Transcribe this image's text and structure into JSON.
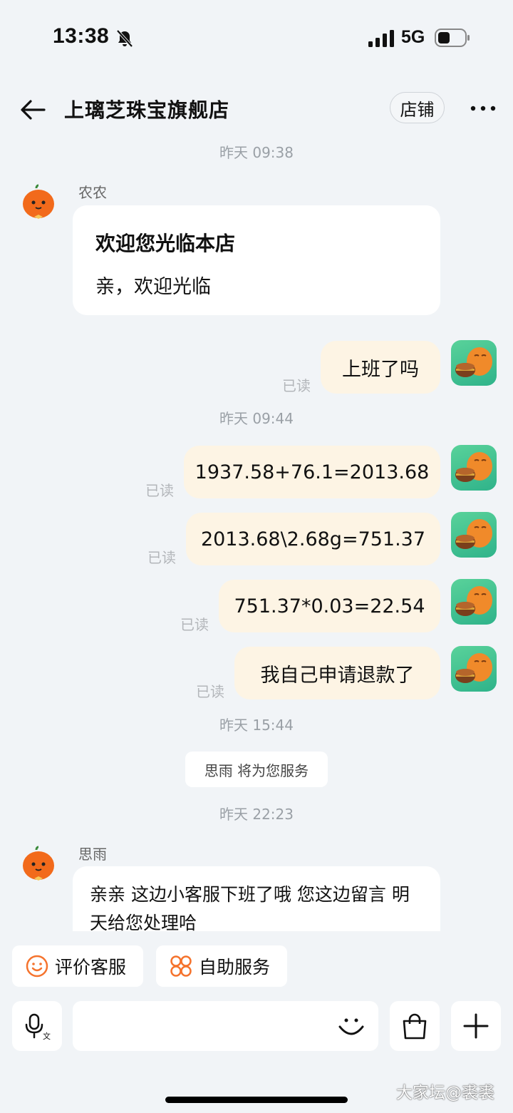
{
  "status_bar": {
    "time": "13:38",
    "network": "5G"
  },
  "header": {
    "title": "上璃芝珠宝旗舰店",
    "shop_label": "店铺"
  },
  "chat": {
    "timestamps": [
      "昨天 09:38",
      "昨天 09:44",
      "昨天 15:44",
      "昨天 22:23"
    ],
    "welcome": {
      "sender": "农农",
      "title": "欢迎您光临本店",
      "text": "亲，欢迎光临"
    },
    "outgoing": [
      {
        "text": "上班了吗",
        "status": "已读"
      },
      {
        "text": "1937.58+76.1=2013.68",
        "status": "已读"
      },
      {
        "text": "2013.68\\2.68g=751.37",
        "status": "已读"
      },
      {
        "text": "751.37*0.03=22.54",
        "status": "已读"
      },
      {
        "text": "我自己申请退款了",
        "status": "已读"
      }
    ],
    "system_notice": "思雨 将为您服务",
    "reply": {
      "sender": "思雨",
      "text": "亲亲 这边小客服下班了哦 您这边留言 明天给您处理哈"
    }
  },
  "quick_actions": [
    {
      "label": "评价客服",
      "icon": "smile-icon",
      "color": "#f5732d"
    },
    {
      "label": "自助服务",
      "icon": "grid-flower-icon",
      "color": "#f5732d"
    }
  ],
  "input_bar": {
    "icons": [
      "voice-to-text-icon",
      "emoji-icon",
      "bag-icon",
      "plus-icon"
    ]
  },
  "watermark": "大家坛@裘裘"
}
